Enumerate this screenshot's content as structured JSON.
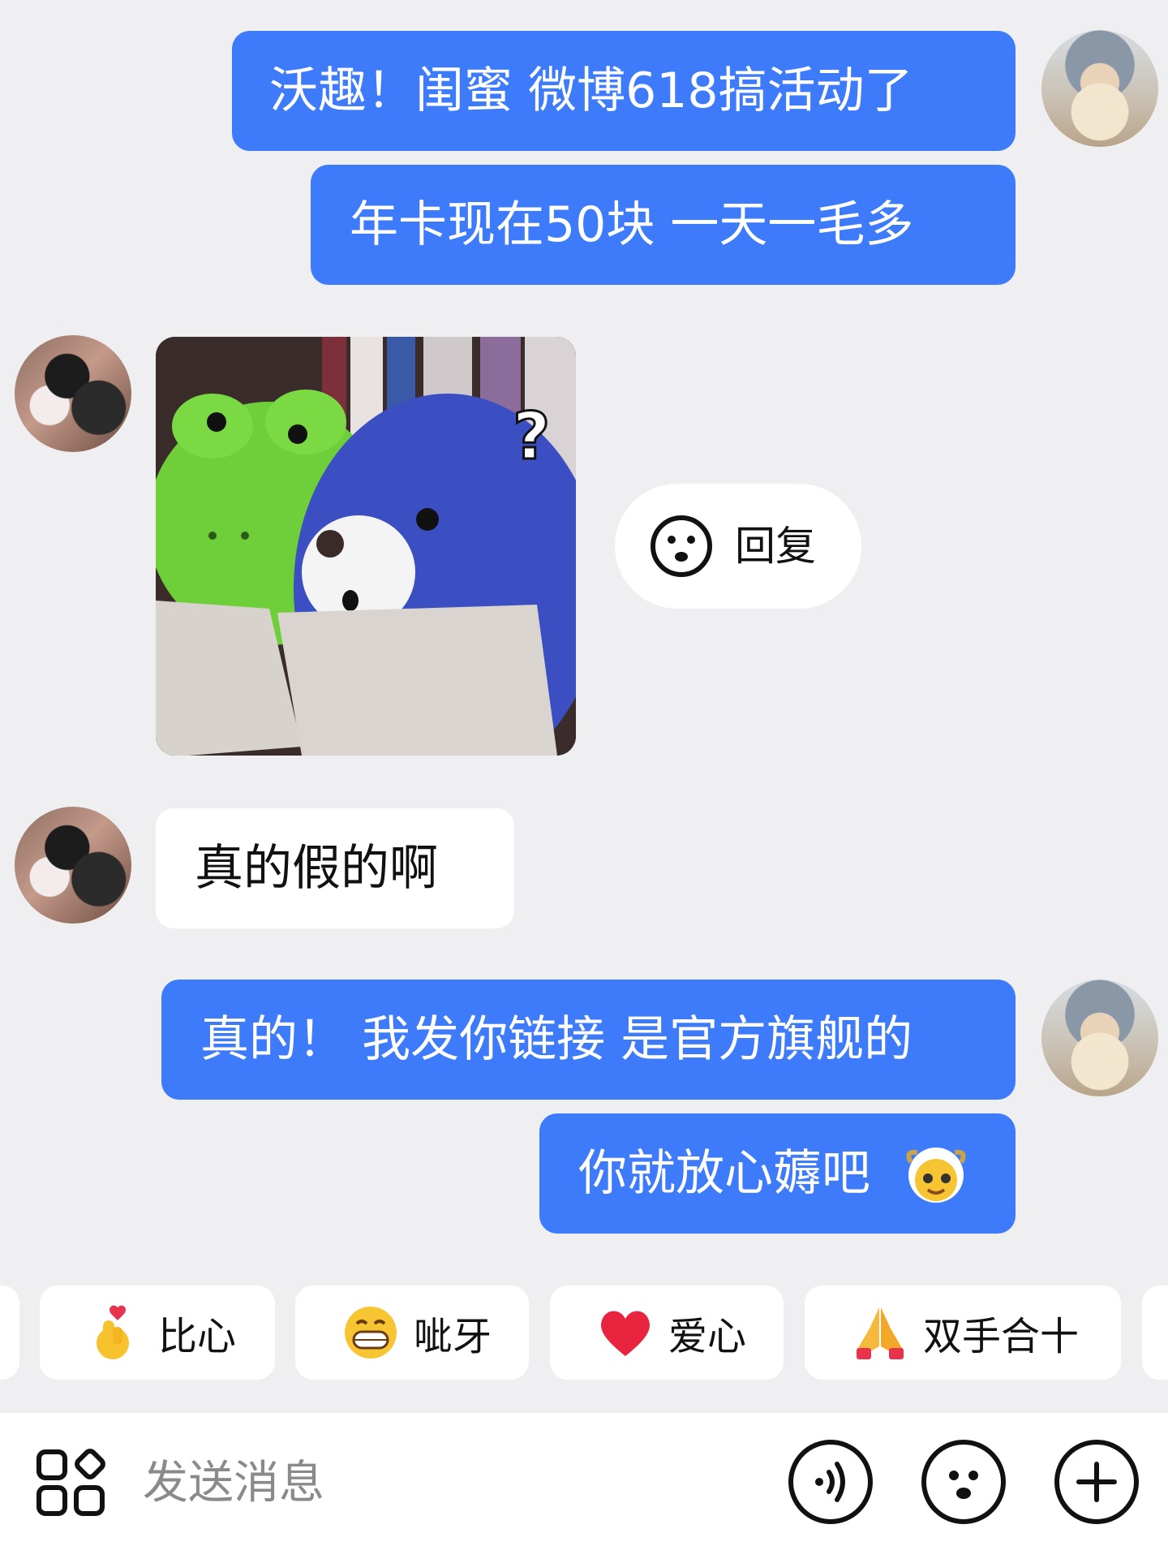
{
  "colors": {
    "accent": "#3d7bfb",
    "background": "#efeff1",
    "bubble_in": "#ffffff"
  },
  "messages": {
    "m1": "沃趣！闺蜜 微博618搞活动了",
    "m2": "年卡现在50块 一天一毛多",
    "m3_sticker_mark": "?",
    "m4": "真的假的啊",
    "m5": "真的！ 我发你链接 是官方旗舰的",
    "m6": "你就放心薅吧"
  },
  "reply": {
    "label": "回复",
    "icon": "smile-face-icon"
  },
  "quick_replies": [
    {
      "label": "比心",
      "icon": "finger-heart-icon"
    },
    {
      "label": "呲牙",
      "icon": "grin-face-icon"
    },
    {
      "label": "爱心",
      "icon": "red-heart-icon"
    },
    {
      "label": "双手合十",
      "icon": "folded-hands-icon"
    }
  ],
  "composer": {
    "placeholder": "发送消息",
    "icons": [
      "apps-grid-icon",
      "voice-icon",
      "emoji-icon",
      "plus-icon"
    ]
  }
}
